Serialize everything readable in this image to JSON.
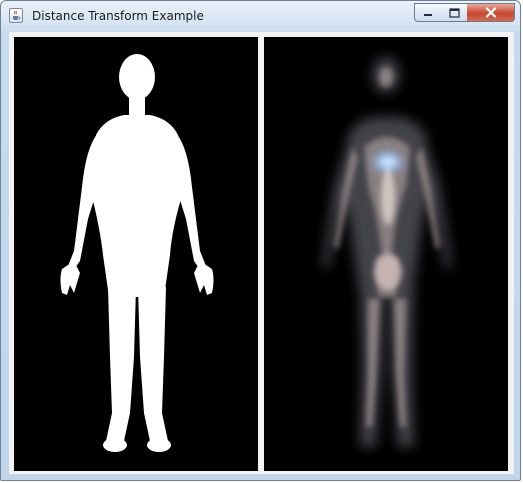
{
  "window": {
    "title": "Distance Transform Example",
    "app_icon": "java-coffee-cup-icon",
    "controls": {
      "minimize_icon": "minimize-icon",
      "maximize_icon": "maximize-icon",
      "close_icon": "close-icon"
    }
  },
  "panels": [
    {
      "name": "source-binary-silhouette",
      "background": "#000000",
      "figure_color": "#ffffff"
    },
    {
      "name": "distance-transform-result",
      "background": "#000000",
      "glow_color": "#cfe3ff"
    }
  ]
}
